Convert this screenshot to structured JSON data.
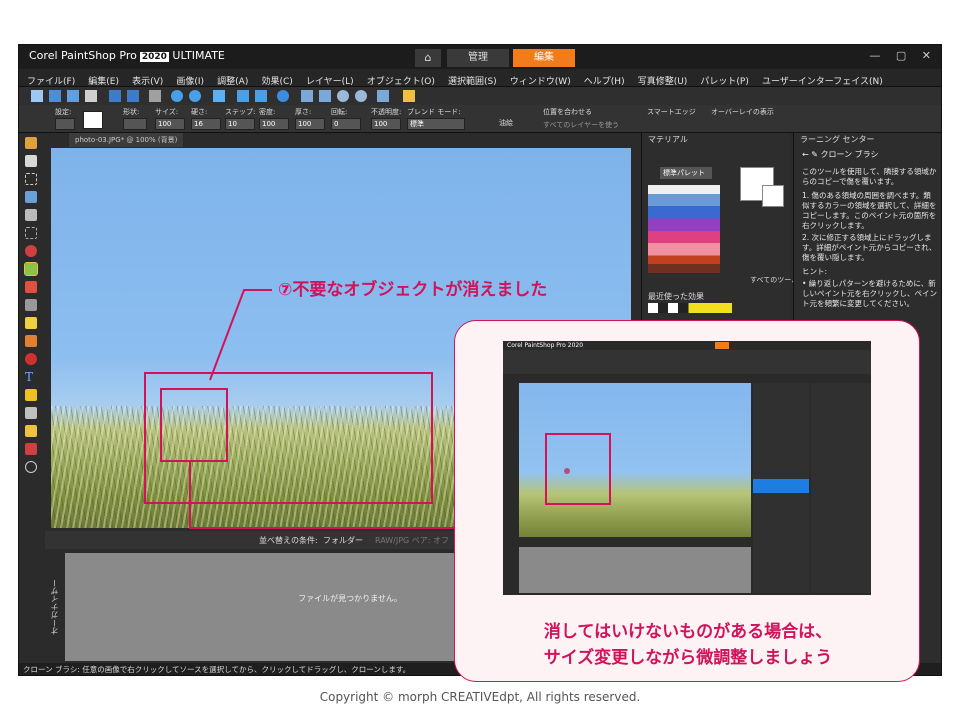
{
  "app": {
    "brand": "Corel PaintShop Pro",
    "version": "2020",
    "edition": "ULTIMATE",
    "tabs": {
      "manage": "管理",
      "edit": "編集"
    },
    "window_controls": "— ▢ ✕"
  },
  "menu": [
    "ファイル(F)",
    "編集(E)",
    "表示(V)",
    "画像(I)",
    "調整(A)",
    "効果(C)",
    "レイヤー(L)",
    "オブジェクト(O)",
    "選択範囲(S)",
    "ウィンドウ(W)",
    "ヘルプ(H)",
    "写真修整(U)",
    "パレット(P)",
    "ユーザーインターフェイス(N)"
  ],
  "options": {
    "preset_label": "設定:",
    "shape_label": "形状:",
    "size_label": "サイズ:",
    "size_value": "100",
    "hardness_label": "硬さ:",
    "hardness_value": "16",
    "step_label": "ステップ:",
    "step_value": "10",
    "density_label": "密度:",
    "density_value": "100",
    "thickness_label": "厚さ:",
    "thickness_value": "100",
    "rotation_label": "回転:",
    "rotation_value": "0",
    "opacity_label": "不透明度:",
    "opacity_value": "100",
    "blend_label": "ブレンド モード:",
    "blend_value": "標準",
    "smart_edge": "スマートエッジ",
    "overlay_label": "オーバーレイの表示",
    "aligned_label": "位置を合わせる",
    "all_layers_label": "すべてのレイヤーを使う",
    "wet_label": "油絵"
  },
  "document": {
    "tab_title": "photo-03.JPG* @ 100% (背景)"
  },
  "materials": {
    "title": "マテリアル",
    "palette_select": "標準パレット",
    "all_tools": "すべてのツール",
    "recent": "最近使った効果"
  },
  "learning_center": {
    "title": "ラーニング センター",
    "tool_name": "クローン ブラシ",
    "intro": "このツールを使用して、隣接する領域からのコピーで傷を覆います。",
    "step1": "1. 傷のある領域の周囲を調べます。類似するカラーの領域を選択して、詳細をコピーします。このペイント元の箇所を右クリックします。",
    "step2": "2. 次に修正する領域上にドラッグします。詳細がペイント元からコピーされ、傷を覆い隠します。",
    "hint_label": "ヒント:",
    "hint1": "• 繰り返しパターンを避けるために、新しいペイント元を右クリックし、ペイント元を頻繁に変更してください。"
  },
  "organizer": {
    "sort_label": "並べ替えの条件:",
    "sort_value": "フォルダー",
    "raw_label": "RAW/JPG ペア: オフ",
    "empty_message": "ファイルが見つかりません。",
    "side_label": "オーガナイザー"
  },
  "status_bar": "クローン ブラシ: 任意の画像で右クリックしてソースを選択してから、クリックしてドラッグし、クローンします。",
  "annotations": {
    "callout": "⑦不要なオブジェクトが消えました",
    "inset_line1": "消してはいけないものがある場合は、",
    "inset_line2": "サイズ変更しながら微調整しましょう",
    "accent_color": "#d1135a"
  },
  "copyright": "Copyright © morph  CREATIVEdpt, All rights reserved."
}
